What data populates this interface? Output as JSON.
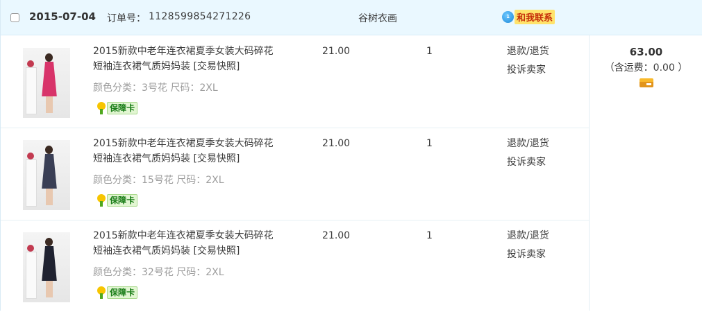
{
  "header": {
    "date": "2015-07-04",
    "order_label": "订单号：",
    "order_number": "1128599854271226",
    "shop_name": "谷树衣画",
    "contact_label": "和我联系",
    "wangwang_badge": "1"
  },
  "items": [
    {
      "title": "2015新款中老年连衣裙夏季女装大码碎花短袖连衣裙气质妈妈装 [交易快照]",
      "sku": "颜色分类：3号花  尺码：2XL",
      "badge": "保障卡",
      "price": "21.00",
      "qty": "1",
      "action_refund": "退款/退货",
      "action_complain": "投诉卖家",
      "dress_color": "#d8346a"
    },
    {
      "title": "2015新款中老年连衣裙夏季女装大码碎花短袖连衣裙气质妈妈装 [交易快照]",
      "sku": "颜色分类：15号花  尺码：2XL",
      "badge": "保障卡",
      "price": "21.00",
      "qty": "1",
      "action_refund": "退款/退货",
      "action_complain": "投诉卖家",
      "dress_color": "#3a3f55"
    },
    {
      "title": "2015新款中老年连衣裙夏季女装大码碎花短袖连衣裙气质妈妈装 [交易快照]",
      "sku": "颜色分类：32号花  尺码：2XL",
      "badge": "保障卡",
      "price": "21.00",
      "qty": "1",
      "action_refund": "退款/退货",
      "action_complain": "投诉卖家",
      "dress_color": "#1f2230"
    }
  ],
  "total": {
    "amount": "63.00",
    "shipping": "（含运费：0.00 ）"
  },
  "colors": {
    "header_bg": "#eaf8ff",
    "contact_bg": "#ffe36b",
    "badge_green": "#1a7d18"
  }
}
